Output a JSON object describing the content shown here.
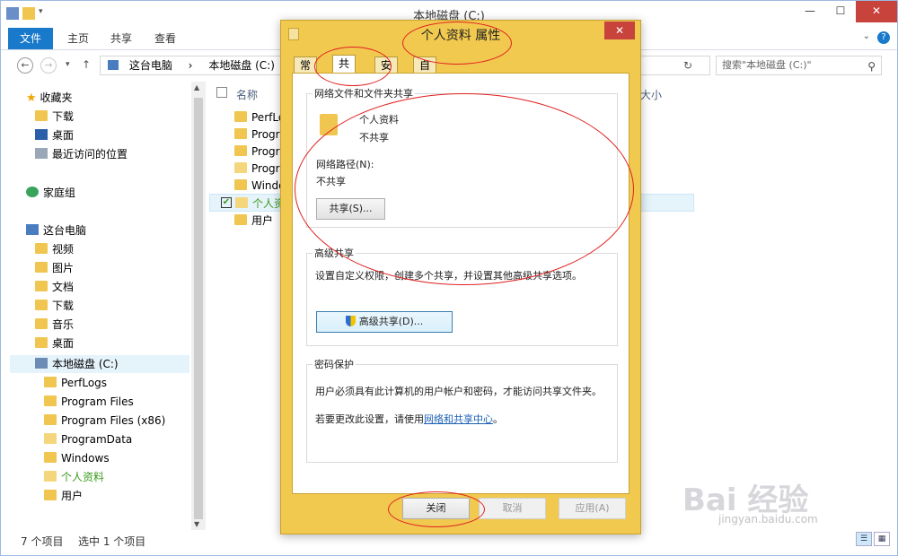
{
  "explorer": {
    "title": "本地磁盘 (C:)",
    "ribbon_tabs": [
      "文件",
      "主页",
      "共享",
      "查看"
    ],
    "address": [
      "这台电脑",
      "本地磁盘 (C:)"
    ],
    "search_placeholder": "搜索\"本地磁盘 (C:)\"",
    "nav": {
      "favorites": "收藏夹",
      "fav_items": [
        "下载",
        "桌面",
        "最近访问的位置"
      ],
      "homegroup": "家庭组",
      "this_pc": "这台电脑",
      "pc_items": [
        "视频",
        "图片",
        "文档",
        "下载",
        "音乐",
        "桌面"
      ],
      "drive": "本地磁盘 (C:)",
      "drive_items": [
        "PerfLogs",
        "Program Files",
        "Program Files (x86)",
        "ProgramData",
        "Windows",
        "个人资料",
        "用户"
      ]
    },
    "columns": {
      "name": "名称",
      "size": "大小"
    },
    "files": [
      "PerfLogs",
      "Progra",
      "Progra",
      "Progra",
      "Windo",
      "个人资",
      "用户"
    ],
    "status": {
      "count": "7 个项目",
      "selected": "选中 1 个项目"
    }
  },
  "dialog": {
    "title": "个人资料 属性",
    "tabs": [
      "常规",
      "共享",
      "安全",
      "自定义"
    ],
    "net_share": {
      "title": "网络文件和文件夹共享",
      "folder_name": "个人资料",
      "folder_state": "不共享",
      "path_label": "网络路径(N):",
      "path_value": "不共享",
      "share_button": "共享(S)..."
    },
    "advanced": {
      "title": "高级共享",
      "desc": "设置自定义权限，创建多个共享，并设置其他高级共享选项。",
      "button": "高级共享(D)..."
    },
    "password": {
      "title": "密码保护",
      "desc": "用户必须具有此计算机的用户帐户和密码，才能访问共享文件夹。",
      "change_prefix": "若要更改此设置，请使用",
      "change_link": "网络和共享中心",
      "change_suffix": "。"
    },
    "buttons": {
      "close": "关闭",
      "cancel": "取消",
      "apply": "应用(A)"
    }
  },
  "watermark": {
    "brand": "Bai 经验",
    "url": "jingyan.baidu.com"
  }
}
